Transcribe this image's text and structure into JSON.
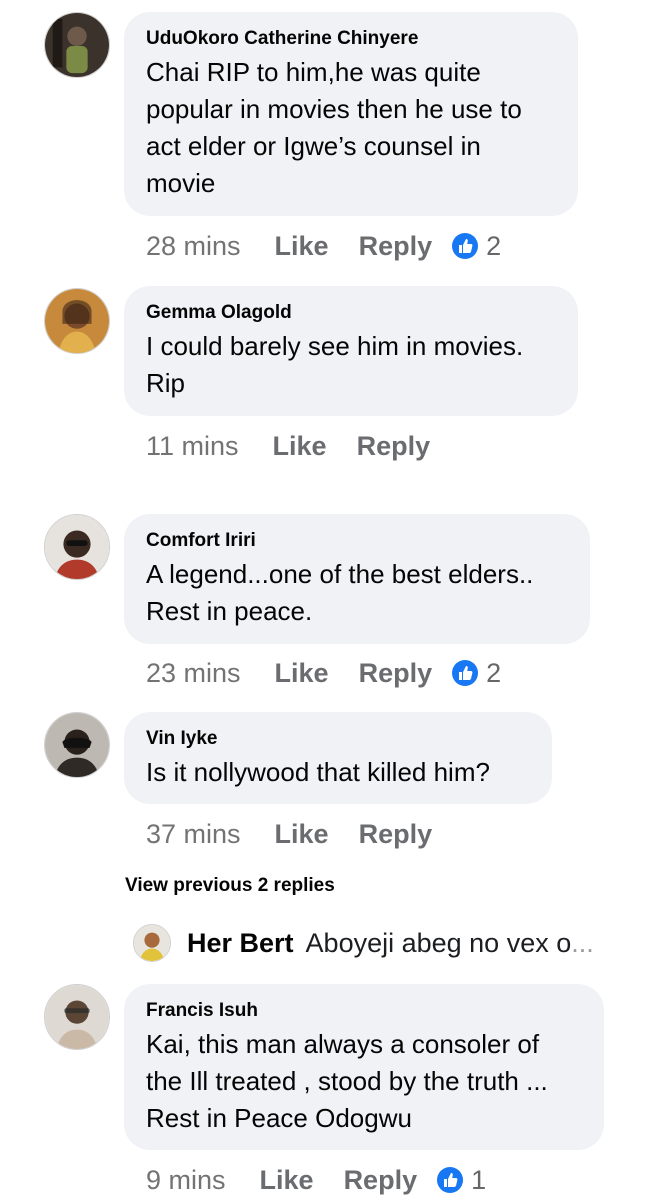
{
  "comments": [
    {
      "author": "UduOkoro Catherine Chinyere",
      "lines": [
        "Chai RIP to him,he was quite",
        "popular in movies then he use to",
        "act elder or Igwe’s  counsel in",
        "movie"
      ],
      "time": "28 mins",
      "like_label": "Like",
      "reply_label": "Reply",
      "reaction_count": "2",
      "avatar_colors": [
        "#2b2622",
        "#6e5a4a"
      ]
    },
    {
      "author": "Gemma Olagold",
      "lines": [
        "I could barely see him in movies.",
        "Rip"
      ],
      "time": "11 mins",
      "like_label": "Like",
      "reply_label": "Reply",
      "reaction_count": "",
      "avatar_colors": [
        "#e0a24a",
        "#7a4a2a"
      ]
    },
    {
      "author": "Comfort Iriri",
      "lines": [
        "A legend...one of the best elders..",
        "Rest in peace."
      ],
      "time": "23 mins",
      "like_label": "Like",
      "reply_label": "Reply",
      "reaction_count": "2",
      "avatar_colors": [
        "#d8d2cc",
        "#3a2a22"
      ]
    },
    {
      "author": "Vin Iyke",
      "lines": [
        "Is it nollywood that killed him?"
      ],
      "time": "37 mins",
      "like_label": "Like",
      "reply_label": "Reply",
      "reaction_count": "",
      "avatar_colors": [
        "#c8c4be",
        "#2a211c"
      ]
    }
  ],
  "view_previous": "View previous 2 replies",
  "reply_preview": {
    "author": "Her Bert",
    "text": "Aboyeji abeg no vex o",
    "ellipsis": "..."
  },
  "last_comment": {
    "author": "Francis Isuh",
    "lines": [
      "Kai,  this man always a consoler of",
      "the Ill treated , stood by the truth ...",
      "Rest in Peace Odogwu"
    ],
    "time": "9 mins",
    "like_label": "Like",
    "reply_label": "Reply",
    "reaction_count": "1",
    "avatar_colors": [
      "#d9d6cf",
      "#5b4636"
    ]
  },
  "colors": {
    "bubble": "#f0f2f5",
    "meta": "#65676b",
    "like_blue": "#1877f2"
  },
  "icons": {
    "reaction": "thumbs-up-icon"
  }
}
